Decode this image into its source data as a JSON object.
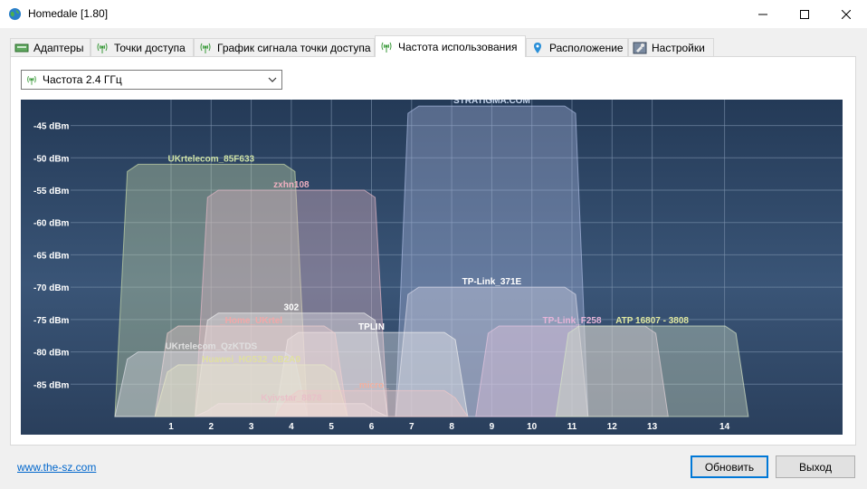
{
  "window": {
    "title": "Homedale [1.80]"
  },
  "tabs": [
    {
      "label": "Адаптеры",
      "icon": "adapter-icon"
    },
    {
      "label": "Точки доступа",
      "icon": "antenna-icon"
    },
    {
      "label": "График сигнала точки доступа",
      "icon": "antenna-icon"
    },
    {
      "label": "Частота использования",
      "icon": "antenna-icon"
    },
    {
      "label": "Расположение",
      "icon": "map-pin-icon"
    },
    {
      "label": "Настройки",
      "icon": "settings-icon"
    }
  ],
  "frequency_select": {
    "value": "Частота 2.4 ГГц"
  },
  "chart_data": {
    "type": "area",
    "x_ticks": [
      "1",
      "2",
      "3",
      "4",
      "5",
      "6",
      "7",
      "8",
      "9",
      "10",
      "11",
      "12",
      "13",
      "14"
    ],
    "y_ticks": [
      "-45 dBm",
      "-50 dBm",
      "-55 dBm",
      "-60 dBm",
      "-65 dBm",
      "-70 dBm",
      "-75 dBm",
      "-80 dBm",
      "-85 dBm"
    ],
    "ylim": [
      -90,
      -41
    ],
    "series": [
      {
        "name": "UKrtelecom_85F633",
        "channel": 2,
        "signal": -51,
        "color": "#c7d9a8",
        "label_color": "#cfe3a6"
      },
      {
        "name": "zxhn108",
        "channel": 4,
        "signal": -55,
        "color": "#e6b8c6",
        "label_color": "#f0b0c0"
      },
      {
        "name": "STRATIGMA.COM",
        "channel": 9,
        "signal": -42,
        "color": "#aab9e0",
        "label_color": "#c8d8f0"
      },
      {
        "name": "TP-Link_371E",
        "channel": 9,
        "signal": -70,
        "color": "#d8d8e8",
        "label_color": "#ffffff"
      },
      {
        "name": "302",
        "channel": 4,
        "signal": -74,
        "color": "#f0f0f0",
        "label_color": "#ffffff"
      },
      {
        "name": "TP-Link_F258",
        "channel": 11,
        "signal": -76,
        "color": "#e6c6e0",
        "label_color": "#e6b4d8"
      },
      {
        "name": "ATP 16807 - 3808",
        "channel": 13,
        "signal": -76,
        "color": "#d8e6c8",
        "label_color": "#e0e8a0"
      },
      {
        "name": "TPLIN",
        "channel": 6,
        "signal": -77,
        "color": "#f0f0f0",
        "label_color": "#ffffff"
      },
      {
        "name": "_Home_UKrtel",
        "channel": 3,
        "signal": -76,
        "color": "#f0d0d0",
        "label_color": "#f2a8a8"
      },
      {
        "name": "UKrtelecom_QzKTDS",
        "channel": 2,
        "signal": -80,
        "color": "#e0e0e8",
        "label_color": "#e0e0e0"
      },
      {
        "name": "Huawei_HG532_0B2A0",
        "channel": 3,
        "signal": -82,
        "color": "#e8e8c8",
        "label_color": "#e0e0a0"
      },
      {
        "name": "_micro_",
        "channel": 6,
        "signal": -86,
        "color": "#f0c8c8",
        "label_color": "#f0b0a0"
      },
      {
        "name": "Kyivstar_8878",
        "channel": 4,
        "signal": -88,
        "color": "#f0e0e0",
        "label_color": "#e8c0c8"
      }
    ]
  },
  "footer": {
    "link": "www.the-sz.com",
    "refresh_label": "Обновить",
    "exit_label": "Выход"
  }
}
